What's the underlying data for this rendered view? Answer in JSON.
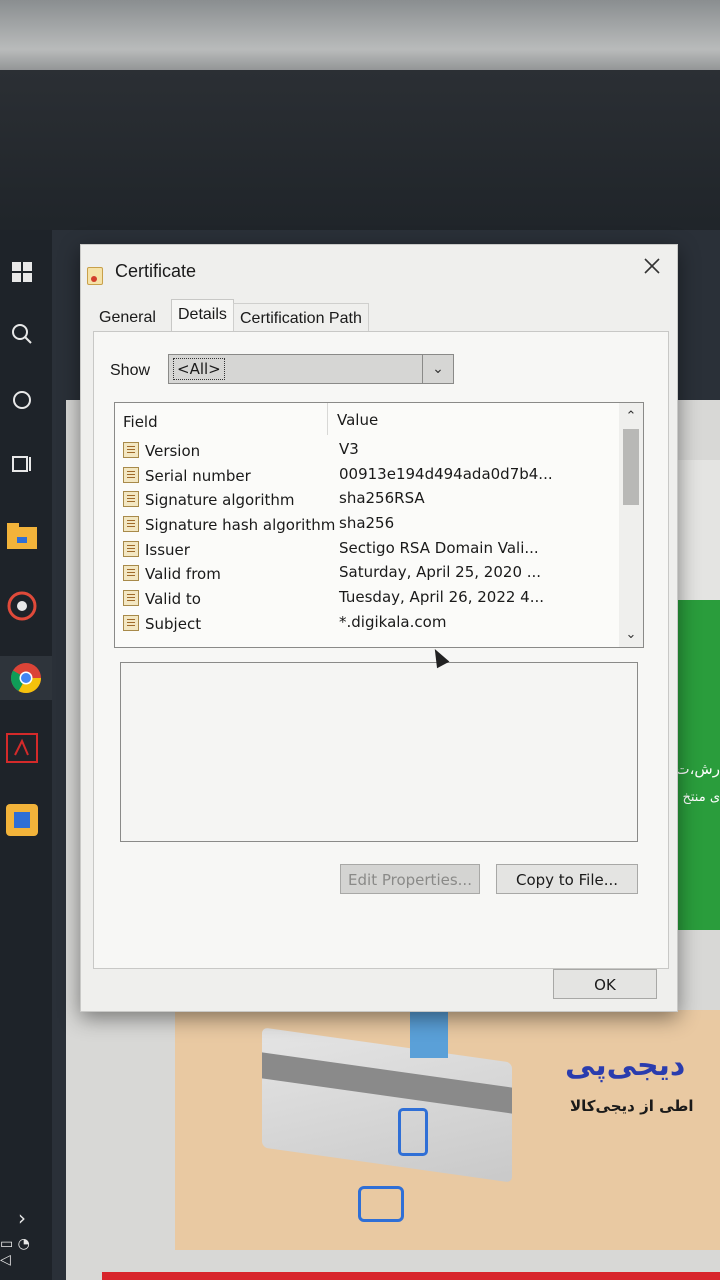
{
  "dialog": {
    "title": "Certificate",
    "tabs": [
      "General",
      "Details",
      "Certification Path"
    ],
    "show_label": "Show",
    "show_value": "<All>",
    "columns": {
      "field": "Field",
      "value": "Value"
    },
    "rows": [
      {
        "field": "Version",
        "value": "V3"
      },
      {
        "field": "Serial number",
        "value": "00913e194d494ada0d7b4..."
      },
      {
        "field": "Signature algorithm",
        "value": "sha256RSA"
      },
      {
        "field": "Signature hash algorithm",
        "value": "sha256"
      },
      {
        "field": "Issuer",
        "value": "Sectigo RSA Domain Vali..."
      },
      {
        "field": "Valid from",
        "value": "Saturday, April 25, 2020 ..."
      },
      {
        "field": "Valid to",
        "value": "Tuesday, April 26, 2022 4..."
      },
      {
        "field": "Subject",
        "value": "*.digikala.com"
      }
    ],
    "buttons": {
      "edit": "Edit Properties...",
      "copy": "Copy to File...",
      "ok": "OK"
    }
  },
  "background": {
    "promo_brand": "دیجی‌پی",
    "promo_sub": "اطی از دیجی‌کالا",
    "green_text": "رش،ت",
    "green_text2": "ی منتخ"
  },
  "colors": {
    "green": "#2a9d3c",
    "brand_blue": "#2a3cae",
    "red_bar": "#d8242b"
  },
  "taskbar_icons": [
    "windows-icon",
    "search-icon",
    "cortana-icon",
    "task-view-icon",
    "folder-icon",
    "media-icon",
    "chrome-icon",
    "acrobat-icon",
    "app-icon"
  ]
}
